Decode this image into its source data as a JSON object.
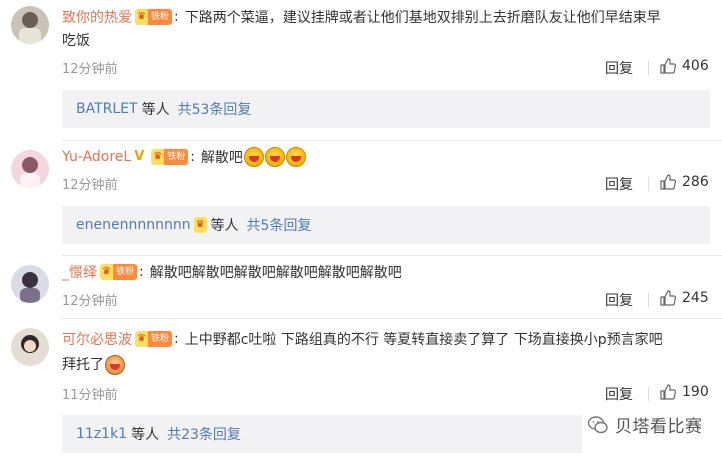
{
  "comments": [
    {
      "username": "致你的热爱",
      "badge": "铁粉",
      "text_line1": "下路两个菜逼，建议挂牌或者让他们基地双排别上去折磨队友让他们早结束早",
      "text_line2": "吃饭",
      "time": "12分钟前",
      "reply_label": "回复",
      "likes": "406",
      "sub_names": "BATRLET",
      "sub_plain": "等人",
      "sub_count": "共53条回复"
    },
    {
      "username": "Yu-AdoreL",
      "badge": "铁粉",
      "text": "解散吧",
      "time": "12分钟前",
      "reply_label": "回复",
      "likes": "286",
      "sub_names": "enenennnnnnnn",
      "sub_plain": "等人",
      "sub_count": "共5条回复"
    },
    {
      "username": "_憬绎",
      "badge": "铁粉",
      "text": "解散吧解散吧解散吧解散吧解散吧解散吧",
      "time": "12分钟前",
      "reply_label": "回复",
      "likes": "245"
    },
    {
      "username": "可尔必思波",
      "badge": "铁粉",
      "text_line1": "上中野都c吐啦 下路组真的不行 等夏转直接卖了算了 下场直接换小p预言家吧",
      "text_line2": "拜托了",
      "time": "11分钟前",
      "reply_label": "回复",
      "likes": "190",
      "sub_names": "11z1k1",
      "sub_plain": "等人",
      "sub_count": "共23条回复"
    }
  ],
  "watermark": "贝塔看比赛",
  "colors": {
    "username": "#eb7350",
    "link": "#507daf",
    "meta": "#999999",
    "sub_bg": "#f2f2f5"
  }
}
